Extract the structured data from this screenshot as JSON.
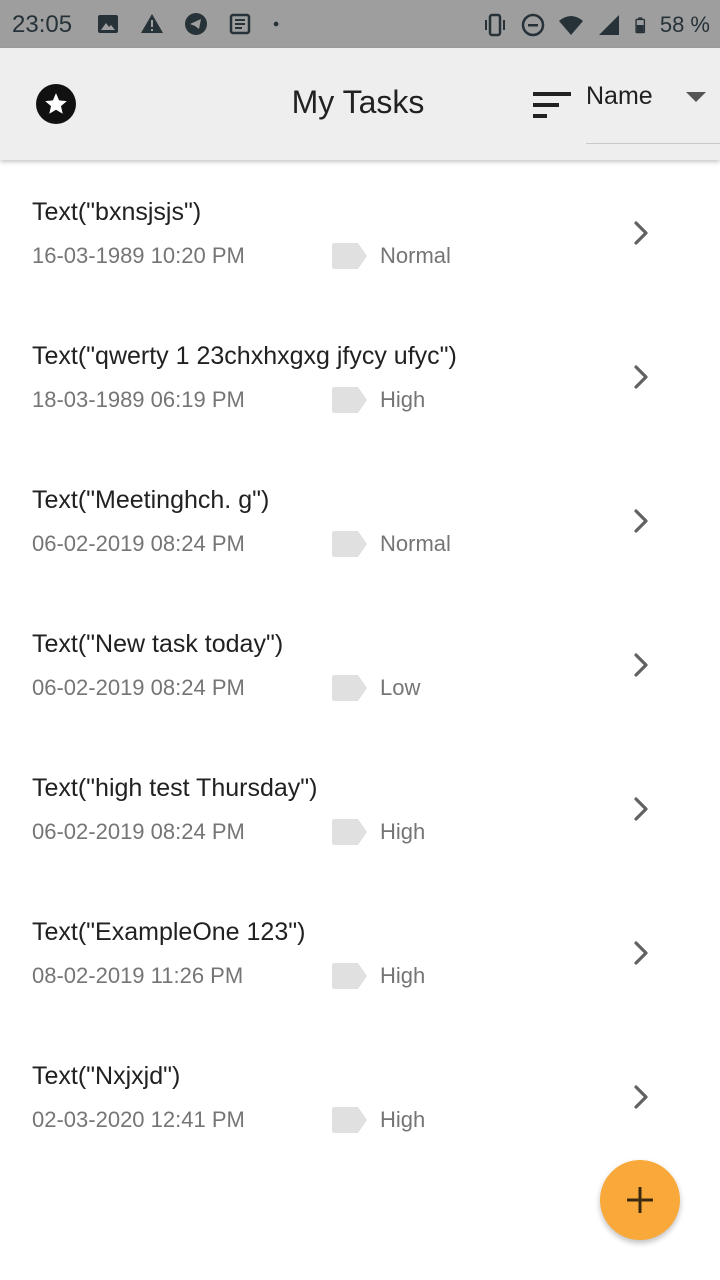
{
  "status_bar": {
    "time": "23:05",
    "battery_text": "58 %",
    "left_icons": [
      "image-icon",
      "warning-icon",
      "telegram-icon",
      "news-icon",
      "dot-icon"
    ],
    "right_icons": [
      "vibrate-icon",
      "do-not-disturb-icon",
      "wifi-icon",
      "cell-signal-icon",
      "battery-icon"
    ]
  },
  "app_bar": {
    "title": "My Tasks",
    "sort_value": "Name",
    "accent_color": "#eeeeee"
  },
  "tasks": [
    {
      "title": "Text(\"bxnsjsjs\")",
      "date": "16-03-1989 10:20 PM",
      "priority": "Normal"
    },
    {
      "title": "Text(\"qwerty 1 23chxhxgxg jfycy ufyc\")",
      "date": "18-03-1989 06:19 PM",
      "priority": "High"
    },
    {
      "title": "Text(\"Meetinghch. g\")",
      "date": "06-02-2019 08:24 PM",
      "priority": "Normal"
    },
    {
      "title": "Text(\"New task today\")",
      "date": "06-02-2019 08:24 PM",
      "priority": "Low"
    },
    {
      "title": "Text(\"high test Thursday\")",
      "date": "06-02-2019 08:24 PM",
      "priority": "High"
    },
    {
      "title": "Text(\"ExampleOne 123\")",
      "date": "08-02-2019 11:26 PM",
      "priority": "High"
    },
    {
      "title": "Text(\"Nxjxjd\")",
      "date": "02-03-2020 12:41 PM",
      "priority": "High"
    }
  ],
  "fab": {
    "icon": "plus-icon",
    "color": "#f9a93a"
  }
}
